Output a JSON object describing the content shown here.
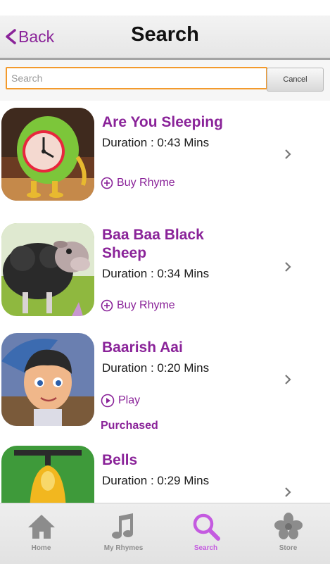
{
  "header": {
    "back_label": "Back",
    "title": "Search"
  },
  "search": {
    "placeholder": "Search",
    "value": "",
    "cancel_label": "Cancel"
  },
  "rhymes": [
    {
      "title": "Are You Sleeping",
      "duration": "Duration : 0:43 Mins",
      "action": "Buy Rhyme",
      "purchased": ""
    },
    {
      "title": "Baa Baa Black Sheep",
      "duration": "Duration : 0:34 Mins",
      "action": "Buy Rhyme",
      "purchased": ""
    },
    {
      "title": "Baarish Aai",
      "duration": "Duration : 0:20 Mins",
      "action": "Play",
      "purchased": "Purchased"
    },
    {
      "title": "Bells",
      "duration": "Duration : 0:29 Mins",
      "action": "",
      "purchased": ""
    }
  ],
  "tabs": [
    {
      "label": "Home",
      "icon": "home-icon"
    },
    {
      "label": "My Rhymes",
      "icon": "music-note-icon"
    },
    {
      "label": "Search",
      "icon": "search-icon",
      "active": true
    },
    {
      "label": "Store",
      "icon": "store-flower-icon"
    }
  ],
  "colors": {
    "accent": "#8a2399",
    "active_tab": "#c45ae0",
    "search_border": "#f39a2c"
  }
}
